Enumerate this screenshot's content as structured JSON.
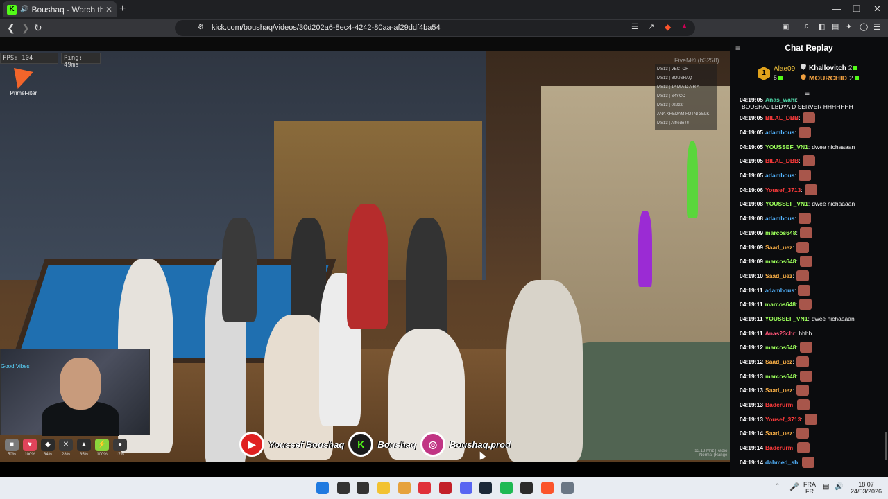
{
  "browser": {
    "tab_title": "Boushaq - Watch the VOD o",
    "tab_favicon": "K",
    "url": "kick.com/boushaq/videos/30d202a6-8ec4-4242-80aa-af29ddf4ba54"
  },
  "game": {
    "fps": "FPS: 104",
    "ping": "Ping: 49ms",
    "brand": "PrimeFilter",
    "server_tag": "FiveM® (b3258)",
    "players": [
      "MS13 | VECTOR",
      "MS13 | BOUSHAQ",
      "MS13 | 1ˢᵗ M A D A R A",
      "MS13 | S4YCO",
      "MS13 | 0z2z2/",
      "ANA KHEDAM FOTNI 3ELK",
      "MS13 | Alfredo !!!"
    ],
    "hud": [
      {
        "icon": "food-icon",
        "glyph": "■",
        "color": "#7a7a7a",
        "value": "50%"
      },
      {
        "icon": "heart-icon",
        "glyph": "♥",
        "color": "#e0445a",
        "value": "100%"
      },
      {
        "icon": "armor-icon",
        "glyph": "◆",
        "color": "#2b2b2b",
        "value": "34%"
      },
      {
        "icon": "cross-icon",
        "glyph": "✕",
        "color": "#3a3a3a",
        "value": "28%"
      },
      {
        "icon": "water-icon",
        "glyph": "▲",
        "color": "#2e2e2e",
        "value": "35%"
      },
      {
        "icon": "stamina-icon",
        "glyph": "⚡",
        "color": "#8ad63c",
        "value": "100%"
      },
      {
        "icon": "mic-icon",
        "glyph": "●",
        "color": "#3a3a3a",
        "value": "17%"
      }
    ],
    "socials": [
      {
        "icon": "youtube-icon",
        "glyph": "▶",
        "bg": "#e02020",
        "label": "Youssef Boushaq"
      },
      {
        "icon": "kick-icon",
        "glyph": "K",
        "bg": "#1a1a1a",
        "fg": "#53fc18",
        "label": "Boushaq"
      },
      {
        "icon": "instagram-icon",
        "glyph": "◎",
        "bg": "#c13584",
        "label": "Boushaq.prod"
      }
    ],
    "version_line1": "13.13 Mhz [Radio]",
    "version_line2": "Normal [Range]",
    "webcam_neon": "Good Vibes"
  },
  "chat": {
    "title": "Chat Replay",
    "leaderboard": {
      "first_rank": "1",
      "first_name": "Alae09",
      "first_count": "5",
      "second_name": "Khallovitch",
      "second_count": "2",
      "third_name": "MOURCHID",
      "third_count": "2"
    },
    "messages": [
      {
        "ts": "04:19:05",
        "user": "Anas_wahi",
        "color": "#4ed8a8",
        "text": "BOUSHA9 LBDYA D SERVER HHHHHHH",
        "emote": false
      },
      {
        "ts": "04:19:05",
        "user": "BILAL_DBB",
        "color": "#ff3b3b",
        "text": "",
        "emote": true
      },
      {
        "ts": "04:19:05",
        "user": "adambous",
        "color": "#53b4ff",
        "text": "",
        "emote": true
      },
      {
        "ts": "04:19:05",
        "user": "YOUSSEF_VN1",
        "color": "#9cff5a",
        "text": "dwee nichaaaan",
        "emote": false
      },
      {
        "ts": "04:19:05",
        "user": "BILAL_DBB",
        "color": "#ff3b3b",
        "text": "",
        "emote": true
      },
      {
        "ts": "04:19:05",
        "user": "adambous",
        "color": "#53b4ff",
        "text": "",
        "emote": true
      },
      {
        "ts": "04:19:06",
        "user": "Yousef_3713",
        "color": "#ff3b3b",
        "text": "",
        "emote": true
      },
      {
        "ts": "04:19:08",
        "user": "YOUSSEF_VN1",
        "color": "#9cff5a",
        "text": "dwee nichaaaan",
        "emote": false
      },
      {
        "ts": "04:19:08",
        "user": "adambous",
        "color": "#53b4ff",
        "text": "",
        "emote": true
      },
      {
        "ts": "04:19:09",
        "user": "marcos648",
        "color": "#9cff5a",
        "text": "",
        "emote": true
      },
      {
        "ts": "04:19:09",
        "user": "Saad_uez",
        "color": "#ffb347",
        "text": "",
        "emote": true
      },
      {
        "ts": "04:19:09",
        "user": "marcos648",
        "color": "#9cff5a",
        "text": "",
        "emote": true
      },
      {
        "ts": "04:19:10",
        "user": "Saad_uez",
        "color": "#ffb347",
        "text": "",
        "emote": true
      },
      {
        "ts": "04:19:11",
        "user": "adambous",
        "color": "#53b4ff",
        "text": "",
        "emote": true
      },
      {
        "ts": "04:19:11",
        "user": "marcos648",
        "color": "#9cff5a",
        "text": "",
        "emote": true
      },
      {
        "ts": "04:19:11",
        "user": "YOUSSEF_VN1",
        "color": "#9cff5a",
        "text": "dwee nichaaaan",
        "emote": false
      },
      {
        "ts": "04:19:11",
        "user": "Anas23chr",
        "color": "#ff5577",
        "text": "hhhh",
        "emote": false
      },
      {
        "ts": "04:19:12",
        "user": "marcos648",
        "color": "#9cff5a",
        "text": "",
        "emote": true
      },
      {
        "ts": "04:19:12",
        "user": "Saad_uez",
        "color": "#ffb347",
        "text": "",
        "emote": true
      },
      {
        "ts": "04:19:13",
        "user": "marcos648",
        "color": "#9cff5a",
        "text": "",
        "emote": true
      },
      {
        "ts": "04:19:13",
        "user": "Saad_uez",
        "color": "#ffb347",
        "text": "",
        "emote": true
      },
      {
        "ts": "04:19:13",
        "user": "Baderurm",
        "color": "#ff3b3b",
        "text": "",
        "emote": true
      },
      {
        "ts": "04:19:13",
        "user": "Yousef_3713",
        "color": "#ff3b3b",
        "text": "",
        "emote": true
      },
      {
        "ts": "04:19:14",
        "user": "Saad_uez",
        "color": "#ffb347",
        "text": "",
        "emote": true
      },
      {
        "ts": "04:19:14",
        "user": "Baderurm",
        "color": "#ff3b3b",
        "text": "",
        "emote": true
      },
      {
        "ts": "04:19:14",
        "user": "dahmed_sh",
        "color": "#53b4ff",
        "text": "",
        "emote": true
      }
    ]
  },
  "taskbar": {
    "lang_top": "FRA",
    "lang_bottom": "FR",
    "time": "18:07",
    "date": "24/03/2026",
    "apps": [
      {
        "name": "start-icon",
        "color": "#1f7ae0"
      },
      {
        "name": "search-icon",
        "color": "#333333"
      },
      {
        "name": "task-view-icon",
        "color": "#333333"
      },
      {
        "name": "file-explorer-icon",
        "color": "#f2c232"
      },
      {
        "name": "chrome-icon",
        "color": "#e6a23c"
      },
      {
        "name": "opera-icon",
        "color": "#e0303a"
      },
      {
        "name": "acrobat-icon",
        "color": "#c3202a"
      },
      {
        "name": "discord-icon",
        "color": "#5865f2"
      },
      {
        "name": "steam-icon",
        "color": "#1b2838"
      },
      {
        "name": "spotify-icon",
        "color": "#1db954"
      },
      {
        "name": "obs-icon",
        "color": "#2b2b2b"
      },
      {
        "name": "brave-icon",
        "color": "#fb542b"
      },
      {
        "name": "settings-icon",
        "color": "#6b7785"
      }
    ]
  }
}
